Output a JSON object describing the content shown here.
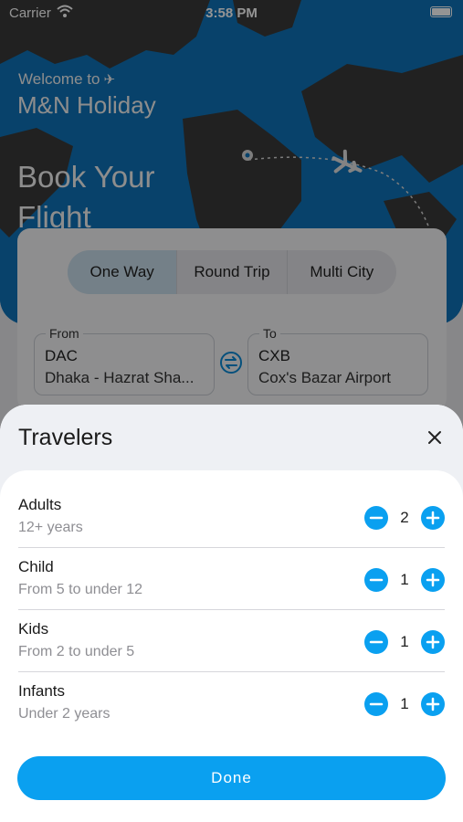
{
  "status_bar": {
    "carrier": "Carrier",
    "time": "3:58 PM"
  },
  "hero": {
    "welcome": "Welcome to",
    "brand": "M&N Holiday",
    "book_title": "Book Your Flight"
  },
  "trip_types": [
    {
      "label": "One Way",
      "selected": true
    },
    {
      "label": "Round Trip",
      "selected": false
    },
    {
      "label": "Multi City",
      "selected": false
    }
  ],
  "from": {
    "label": "From",
    "code": "DAC",
    "name": "Dhaka - Hazrat Sha..."
  },
  "to": {
    "label": "To",
    "code": "CXB",
    "name": "Cox's Bazar Airport"
  },
  "travelers_sheet": {
    "title": "Travelers",
    "rows": [
      {
        "title": "Adults",
        "subtitle": "12+ years",
        "count": "2"
      },
      {
        "title": "Child",
        "subtitle": "From 5 to under 12",
        "count": "1"
      },
      {
        "title": "Kids",
        "subtitle": "From 2 to under 5",
        "count": "1"
      },
      {
        "title": "Infants",
        "subtitle": "Under 2 years",
        "count": "1"
      }
    ],
    "done_label": "Done"
  },
  "colors": {
    "accent": "#0aa0f0",
    "hero_blue": "#0f73b8",
    "land": "#3a3a3a"
  }
}
